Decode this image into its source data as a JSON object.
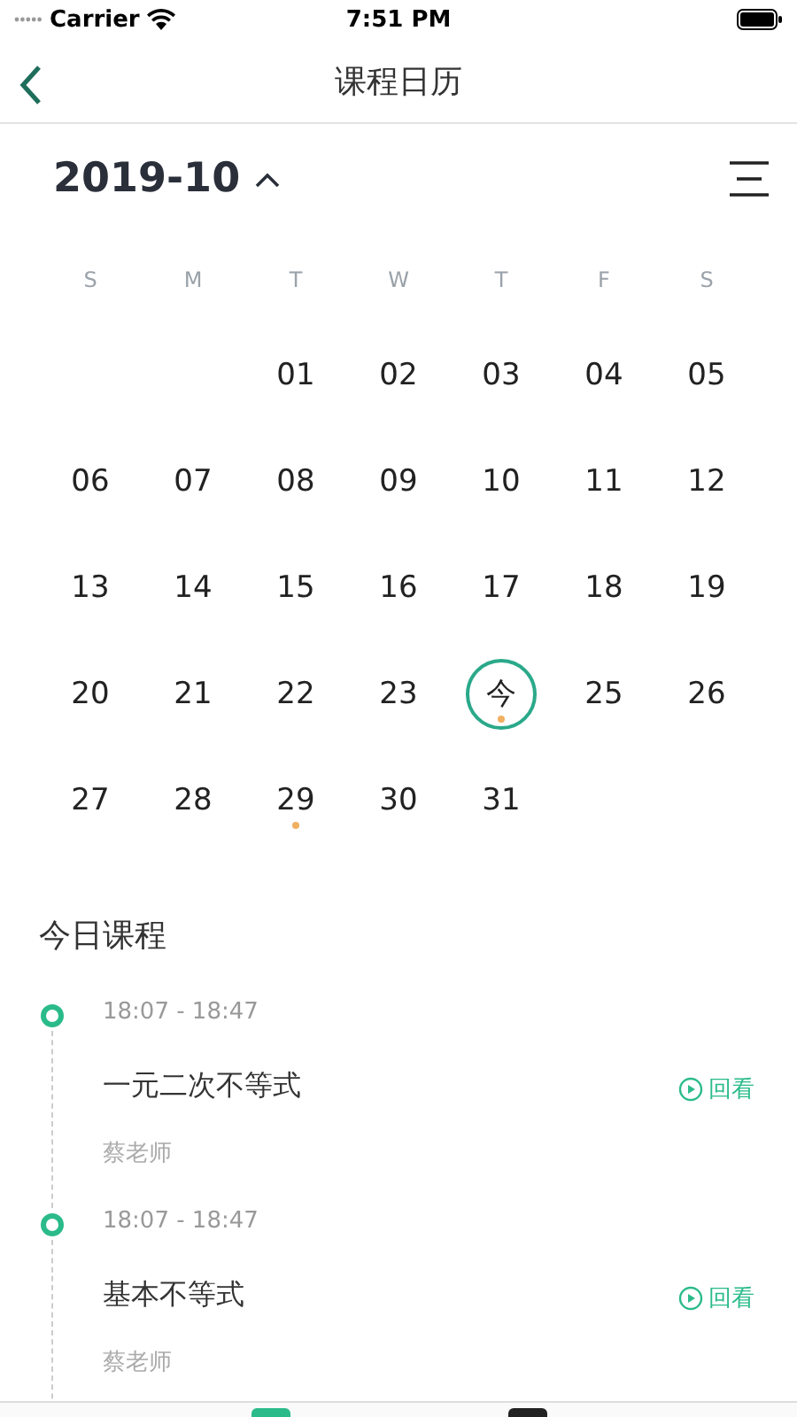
{
  "status_bar": {
    "carrier": "Carrier",
    "time": "7:51 PM"
  },
  "nav": {
    "title": "课程日历"
  },
  "calendar": {
    "month": "2019-10",
    "expanded": true,
    "weekdays": [
      "S",
      "M",
      "T",
      "W",
      "T",
      "F",
      "S"
    ],
    "weeks": [
      [
        {
          "label": "01",
          "today": false,
          "dot": false
        },
        {
          "label": "02",
          "today": false,
          "dot": false
        },
        {
          "label": "03",
          "today": false,
          "dot": false
        },
        {
          "label": "04",
          "today": false,
          "dot": false
        },
        {
          "label": "05",
          "today": false,
          "dot": false
        }
      ],
      [
        {
          "label": "06",
          "today": false,
          "dot": false
        },
        {
          "label": "07",
          "today": false,
          "dot": false
        },
        {
          "label": "08",
          "today": false,
          "dot": false
        },
        {
          "label": "09",
          "today": false,
          "dot": false
        },
        {
          "label": "10",
          "today": false,
          "dot": false
        },
        {
          "label": "11",
          "today": false,
          "dot": false
        },
        {
          "label": "12",
          "today": false,
          "dot": false
        }
      ],
      [
        {
          "label": "13",
          "today": false,
          "dot": false
        },
        {
          "label": "14",
          "today": false,
          "dot": false
        },
        {
          "label": "15",
          "today": false,
          "dot": false
        },
        {
          "label": "16",
          "today": false,
          "dot": false
        },
        {
          "label": "17",
          "today": false,
          "dot": false
        },
        {
          "label": "18",
          "today": false,
          "dot": false
        },
        {
          "label": "19",
          "today": false,
          "dot": false
        }
      ],
      [
        {
          "label": "20",
          "today": false,
          "dot": false
        },
        {
          "label": "21",
          "today": false,
          "dot": false
        },
        {
          "label": "22",
          "today": false,
          "dot": false
        },
        {
          "label": "23",
          "today": false,
          "dot": false
        },
        {
          "label": "今",
          "today": true,
          "dot": true
        },
        {
          "label": "25",
          "today": false,
          "dot": false
        },
        {
          "label": "26",
          "today": false,
          "dot": false
        }
      ],
      [
        {
          "label": "27",
          "today": false,
          "dot": false
        },
        {
          "label": "28",
          "today": false,
          "dot": false
        },
        {
          "label": "29",
          "today": false,
          "dot": true
        },
        {
          "label": "30",
          "today": false,
          "dot": false
        },
        {
          "label": "31",
          "today": false,
          "dot": false
        }
      ]
    ]
  },
  "today_section": {
    "title": "今日课程",
    "courses": [
      {
        "time": "18:07 - 18:47",
        "name": "一元二次不等式",
        "teacher": "蔡老师",
        "action": "回看"
      },
      {
        "time": "18:07 - 18:47",
        "name": "基本不等式",
        "teacher": "蔡老师",
        "action": "回看"
      }
    ]
  }
}
